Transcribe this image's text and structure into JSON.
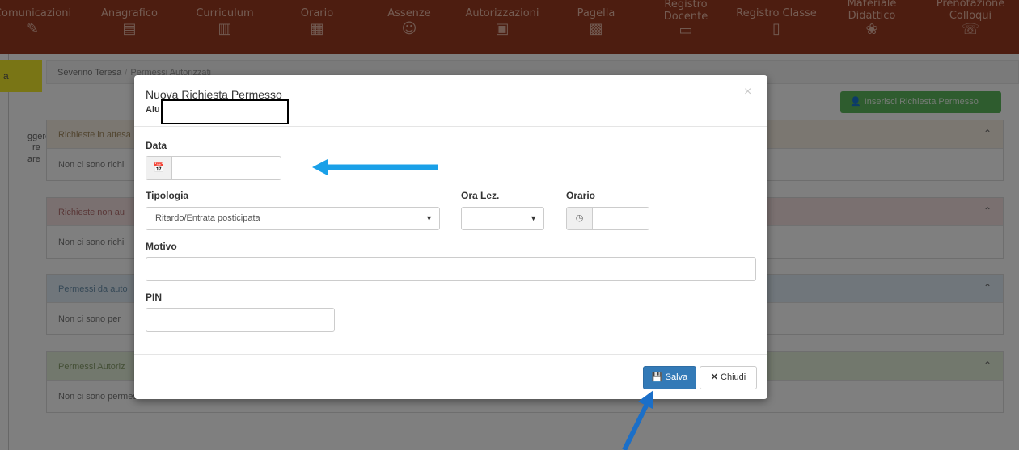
{
  "nav": [
    {
      "label": "Comunicazioni",
      "icon": "pencils-icon"
    },
    {
      "label": "Anagrafico",
      "icon": "document-icon"
    },
    {
      "label": "Curriculum",
      "icon": "document-lines-icon"
    },
    {
      "label": "Orario",
      "icon": "calendar-clock-icon"
    },
    {
      "label": "Assenze",
      "icon": "face-icon"
    },
    {
      "label": "Autorizzazioni",
      "icon": "calendar-check-icon"
    },
    {
      "label": "Pagella",
      "icon": "report-card-icon"
    },
    {
      "label": "Registro Docente",
      "icon": "register-book-icon"
    },
    {
      "label": "Registro Classe",
      "icon": "book-icon"
    },
    {
      "label": "Materiale Didattico",
      "icon": "materials-icon"
    },
    {
      "label": "Prenotazione Colloqui",
      "icon": "chat-icon"
    }
  ],
  "sidebar": {
    "active_label": "a",
    "lines": [
      "ggere",
      "re",
      "are"
    ]
  },
  "breadcrumb": {
    "name": "Severino Teresa",
    "separator": "/",
    "current": "Permessi Autorizzati"
  },
  "insert_button": "Inserisci Richiesta Permesso",
  "panels": [
    {
      "title": "Richieste in attesa",
      "body": "Non ci sono richi"
    },
    {
      "title": "Richieste non au",
      "body": "Non ci sono richi"
    },
    {
      "title": "Permessi da auto",
      "body": "Non ci sono per"
    },
    {
      "title": "Permessi Autoriz",
      "body": "Non ci sono permessi autorizzati"
    }
  ],
  "modal": {
    "title": "Nuova Richiesta Permesso",
    "subtitle": "Alu",
    "close_symbol": "×",
    "data_label": "Data",
    "data_value": "",
    "tipologia_label": "Tipologia",
    "tipologia_value": "Ritardo/Entrata posticipata",
    "ora_lez_label": "Ora Lez.",
    "ora_lez_value": "",
    "orario_label": "Orario",
    "orario_value": "",
    "motivo_label": "Motivo",
    "motivo_value": "",
    "pin_label": "PIN",
    "pin_value": "",
    "save_label": "Salva",
    "close_label": "Chiudi"
  },
  "colors": {
    "navbar": "#9a3a20",
    "save": "#337ab7",
    "insert": "#5cb85c",
    "arrow": "#1aa0e8",
    "arrow_dark": "#1b6fc8"
  }
}
